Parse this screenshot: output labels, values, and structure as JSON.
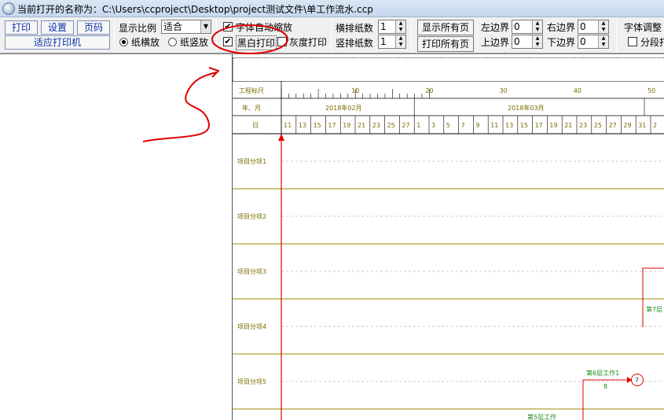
{
  "window": {
    "title": "当前打开的名称为：C:\\Users\\ccproject\\Desktop\\project测试文件\\单工作流水.ccp"
  },
  "toolbar": {
    "print_label": "打印",
    "settings_label": "设置",
    "pagecode_label": "页码",
    "fit_printer_label": "适应打印机",
    "scale_label": "显示比例",
    "scale_value": "适合",
    "landscape_label": "纸横放",
    "portrait_label": "纸竖放",
    "auto_font_label": "字体自动缩放",
    "auto_font_checked": "✔",
    "bw_print_label": "黑白打印",
    "bw_print_checked": "✔",
    "gray_print_label": "灰度打印",
    "h_sheets_label": "横排纸数",
    "h_sheets_value": "1",
    "v_sheets_label": "竖排纸数",
    "v_sheets_value": "1",
    "show_all_label": "显示所有页",
    "print_all_label": "打印所有页",
    "left_margin_label": "左边界",
    "left_margin_value": "0",
    "top_margin_label": "上边界",
    "top_margin_value": "0",
    "right_margin_label": "右边界",
    "right_margin_value": "0",
    "bottom_margin_label": "下边界",
    "bottom_margin_value": "0",
    "font_adjust_label": "字体调整",
    "segment_label": "分段打"
  },
  "gantt": {
    "ruler_label": "工程标尺",
    "ruler_ticks": [
      "10",
      "20",
      "30",
      "40",
      "50"
    ],
    "month_row_label": "年、月",
    "months": [
      "2018年02月",
      "2018年03月"
    ],
    "day_row_label": "日",
    "days": [
      "11",
      "13",
      "15",
      "17",
      "19",
      "21",
      "23",
      "25",
      "27",
      "1",
      "3",
      "5",
      "7",
      "9",
      "11",
      "13",
      "15",
      "17",
      "19",
      "21",
      "23",
      "25",
      "27",
      "29",
      "31",
      "2"
    ],
    "rows": [
      "项目分项1",
      "项目分项2",
      "项目分项3",
      "项目分项4",
      "项目分项5"
    ],
    "tasks": [
      {
        "label": "第7层",
        "duration": ""
      },
      {
        "label": "第6层工作1",
        "duration": "8",
        "node": "7"
      },
      {
        "label": "第5层工作",
        "duration": ""
      }
    ],
    "colors": {
      "accent_red": "#e00000",
      "row_line": "#a08a00",
      "task_green": "#1a8a1a"
    }
  }
}
